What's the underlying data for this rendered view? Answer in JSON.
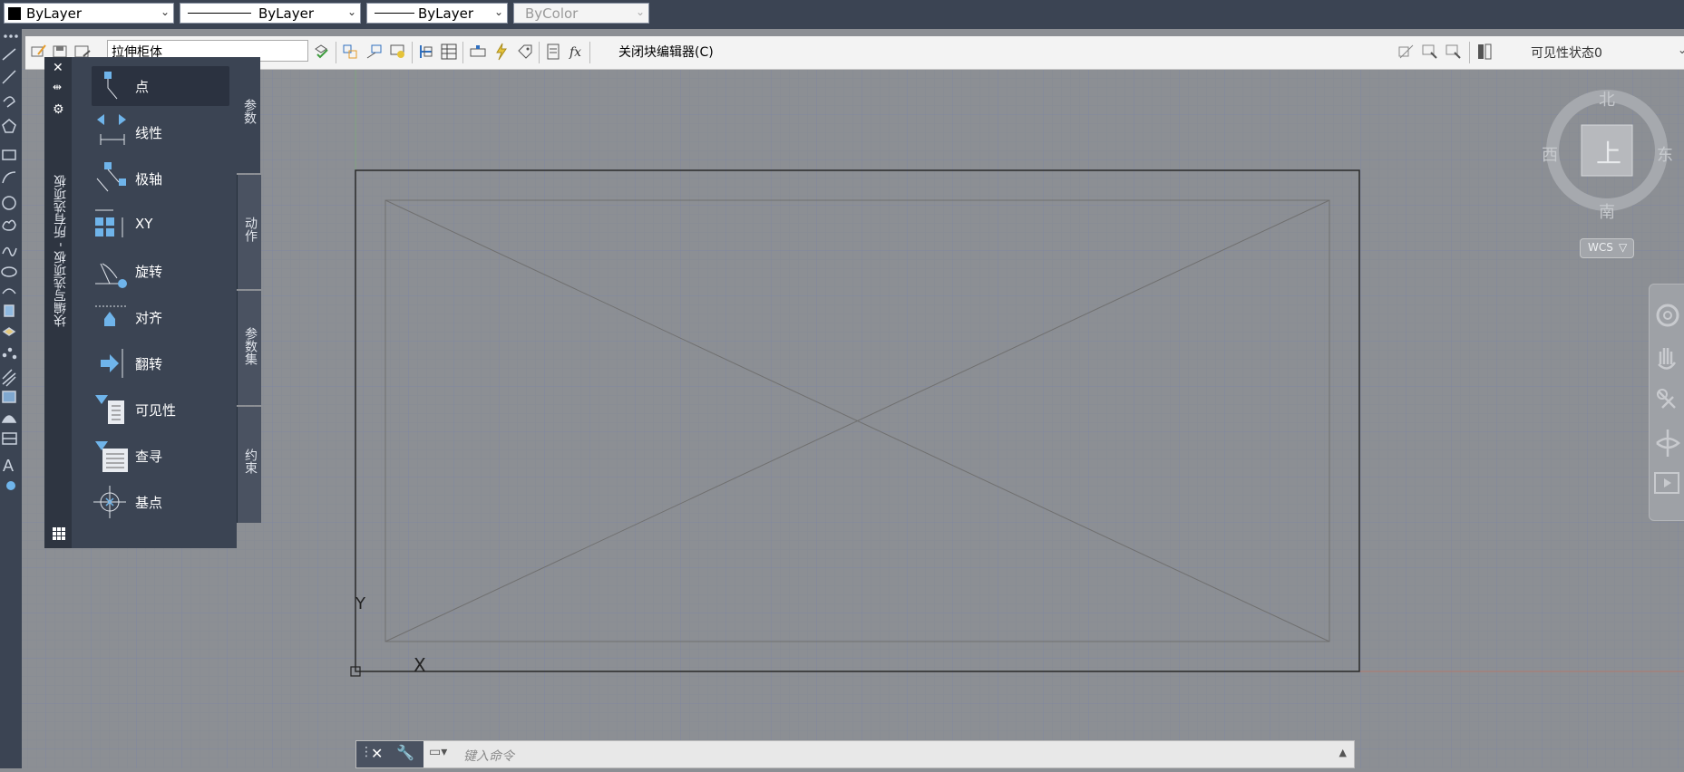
{
  "properties_bar": {
    "color": "ByLayer",
    "linetype": "ByLayer",
    "lineweight": "ByLayer",
    "plotstyle": "ByColor"
  },
  "block_editor": {
    "block_name": "拉伸柜体",
    "close_label": "关闭块编辑器(C)",
    "visibility_state": "可见性状态0"
  },
  "palette": {
    "title": "块编写选项板 - 所有选项板",
    "items": [
      {
        "label": "点",
        "icon": "point-parameter-icon",
        "selected": true
      },
      {
        "label": "线性",
        "icon": "linear-parameter-icon"
      },
      {
        "label": "极轴",
        "icon": "polar-parameter-icon"
      },
      {
        "label": "XY",
        "icon": "xy-parameter-icon"
      },
      {
        "label": "旋转",
        "icon": "rotation-parameter-icon"
      },
      {
        "label": "对齐",
        "icon": "alignment-parameter-icon"
      },
      {
        "label": "翻转",
        "icon": "flip-parameter-icon"
      },
      {
        "label": "可见性",
        "icon": "visibility-parameter-icon"
      },
      {
        "label": "查寻",
        "icon": "lookup-parameter-icon"
      },
      {
        "label": "基点",
        "icon": "basepoint-parameter-icon"
      }
    ],
    "tabs": [
      "参数",
      "动作",
      "参数集",
      "约束"
    ]
  },
  "viewcube": {
    "north": "北",
    "south": "南",
    "east": "东",
    "west": "西",
    "face": "上",
    "wcs": "WCS"
  },
  "ucs": {
    "x": "X",
    "y": "Y"
  },
  "command": {
    "placeholder": "键入命令"
  },
  "colors": {
    "panel": "#3b4453",
    "canvas": "#8c8f94",
    "accent_icon": "#6fb4ea"
  }
}
